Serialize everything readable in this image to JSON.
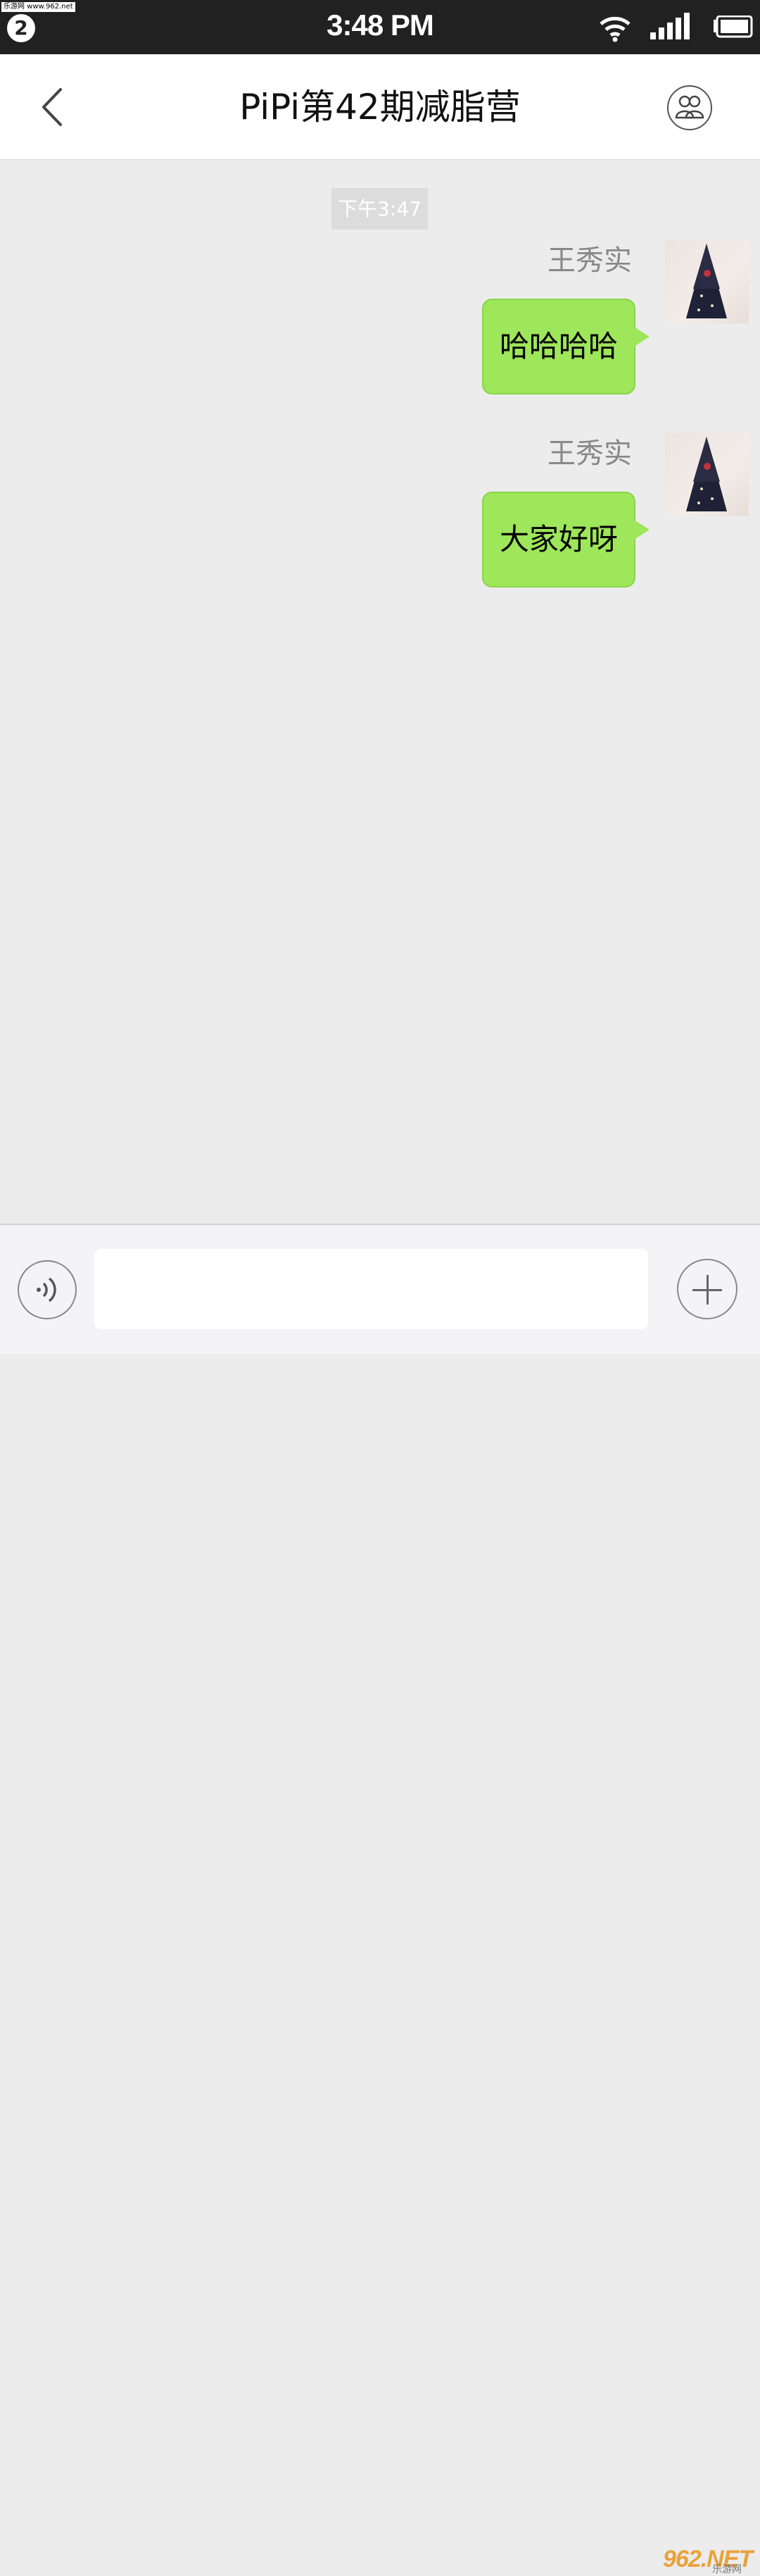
{
  "status_bar": {
    "watermark": "乐游网 www.962.net",
    "notification_count": "2",
    "time": "3:48 PM",
    "icons": [
      "wifi-icon",
      "signal-icon",
      "battery-icon"
    ]
  },
  "header": {
    "title": "PiPi第42期减脂营",
    "back_icon": "chevron-left-icon",
    "members_icon": "group-members-icon"
  },
  "chat": {
    "timestamp": "下午3:47",
    "messages": [
      {
        "sender": "王秀实",
        "text": "哈哈哈哈",
        "outgoing": true
      },
      {
        "sender": "王秀实",
        "text": "大家好呀",
        "outgoing": true
      }
    ]
  },
  "input_bar": {
    "voice_icon": "voice-input-icon",
    "text_value": "",
    "plus_icon": "plus-icon"
  },
  "watermark_bottom": {
    "main": "962.NET",
    "sub": "乐游网"
  },
  "colors": {
    "status_bar": "#212121",
    "chat_background": "#ececec",
    "bubble_outgoing": "#9ee65a",
    "timestamp_bg": "#dcdcdc"
  }
}
